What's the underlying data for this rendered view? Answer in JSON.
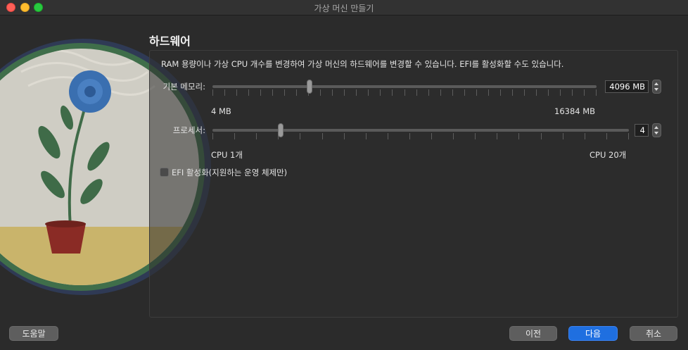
{
  "window": {
    "title": "가상 머신 만들기"
  },
  "section": {
    "title": "하드웨어",
    "description": "RAM 용량이나 가상 CPU 개수를 변경하여 가상 머신의 하드웨어를 변경할 수 있습니다. EFI를 활성화할 수도 있습니다."
  },
  "memory": {
    "label": "기본 메모리:",
    "value": "4096 MB",
    "min_label": "4 MB",
    "max_label": "16384 MB",
    "min": 4,
    "max": 16384,
    "current": 4096
  },
  "processor": {
    "label": "프로세서:",
    "value": "4",
    "min_label": "CPU 1개",
    "max_label": "CPU 20개",
    "min": 1,
    "max": 20,
    "current": 4
  },
  "efi": {
    "label": "EFI 활성화(지원하는 운영 체제만)",
    "checked": false
  },
  "buttons": {
    "help": "도움말",
    "back": "이전",
    "next": "다음",
    "cancel": "취소"
  },
  "colors": {
    "accent": "#1f6fe0",
    "close": "#fe5f57",
    "minimize": "#febc2e",
    "maximize": "#28c840"
  }
}
